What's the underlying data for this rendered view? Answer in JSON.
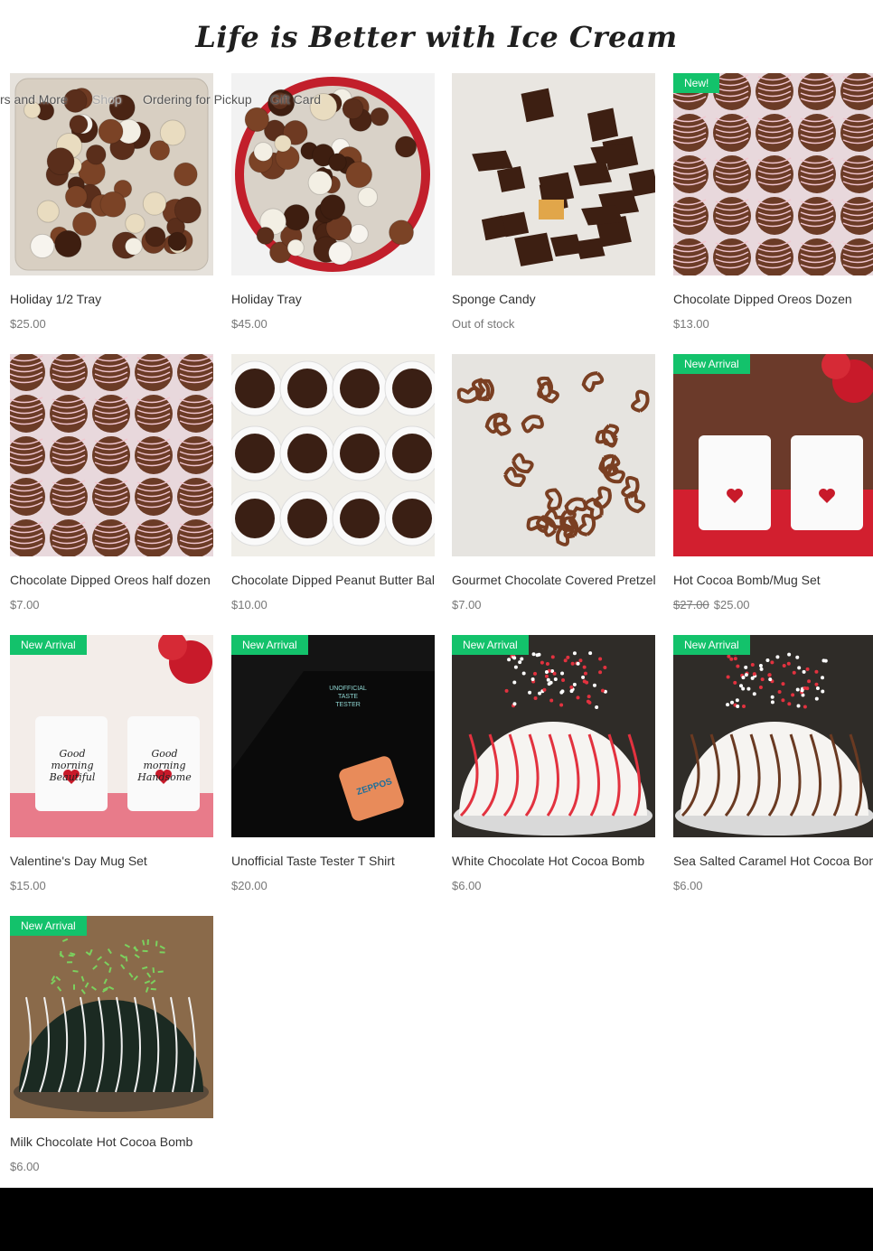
{
  "site": {
    "title": "Life is Better with Ice Cream"
  },
  "nav": {
    "items": [
      "rs and More",
      "Shop",
      "Ordering for Pickup",
      "Gift Card"
    ]
  },
  "products": [
    {
      "name": "Holiday 1/2 Tray",
      "price": "$25.00",
      "image": "holiday-half-tray-photo"
    },
    {
      "name": "Holiday Tray",
      "price": "$45.00",
      "image": "holiday-tray-photo"
    },
    {
      "name": "Sponge Candy",
      "price": "Out of stock",
      "image": "sponge-candy-photo"
    },
    {
      "name": "Chocolate Dipped Oreos Dozen",
      "price": "$13.00",
      "badge": "New!",
      "image": "oreos-dozen-photo"
    },
    {
      "name": "Chocolate Dipped Oreos half dozen",
      "price": "$7.00",
      "image": "oreos-half-dozen-photo"
    },
    {
      "name": "Chocolate Dipped Peanut Butter Balls",
      "price": "$10.00",
      "image": "peanut-butter-balls-photo"
    },
    {
      "name": "Gourmet Chocolate Covered Pretzels",
      "price": "$7.00",
      "image": "pretzels-photo"
    },
    {
      "name": "Hot Cocoa Bomb/Mug Set",
      "old_price": "$27.00",
      "price": "$25.00",
      "badge": "New Arrival",
      "image": "cocoa-mug-set-photo"
    },
    {
      "name": "Valentine's Day Mug Set",
      "price": "$15.00",
      "badge": "New Arrival",
      "image": "valentine-mugs-photo",
      "mug_text_1": "Good morning Beautiful",
      "mug_text_2": "Good morning Handsome"
    },
    {
      "name": "Unofficial Taste Tester T Shirt",
      "price": "$20.00",
      "badge": "New Arrival",
      "image": "tshirt-photo",
      "shirt_text": "UNOFFICIAL TASTE TESTER",
      "cup_text": "ZEPPOS"
    },
    {
      "name": "White Chocolate Hot Cocoa Bomb",
      "price": "$6.00",
      "badge": "New Arrival",
      "image": "white-cocoa-bomb-photo"
    },
    {
      "name": "Sea Salted Caramel Hot Cocoa Bomb",
      "price": "$6.00",
      "badge": "New Arrival",
      "image": "caramel-cocoa-bomb-photo"
    },
    {
      "name": "Milk Chocolate Hot Cocoa Bomb",
      "price": "$6.00",
      "badge": "New Arrival",
      "image": "milk-cocoa-bomb-photo"
    }
  ],
  "colors": {
    "badge": "#13c26b",
    "footer": "#000000",
    "price": "#777777"
  }
}
